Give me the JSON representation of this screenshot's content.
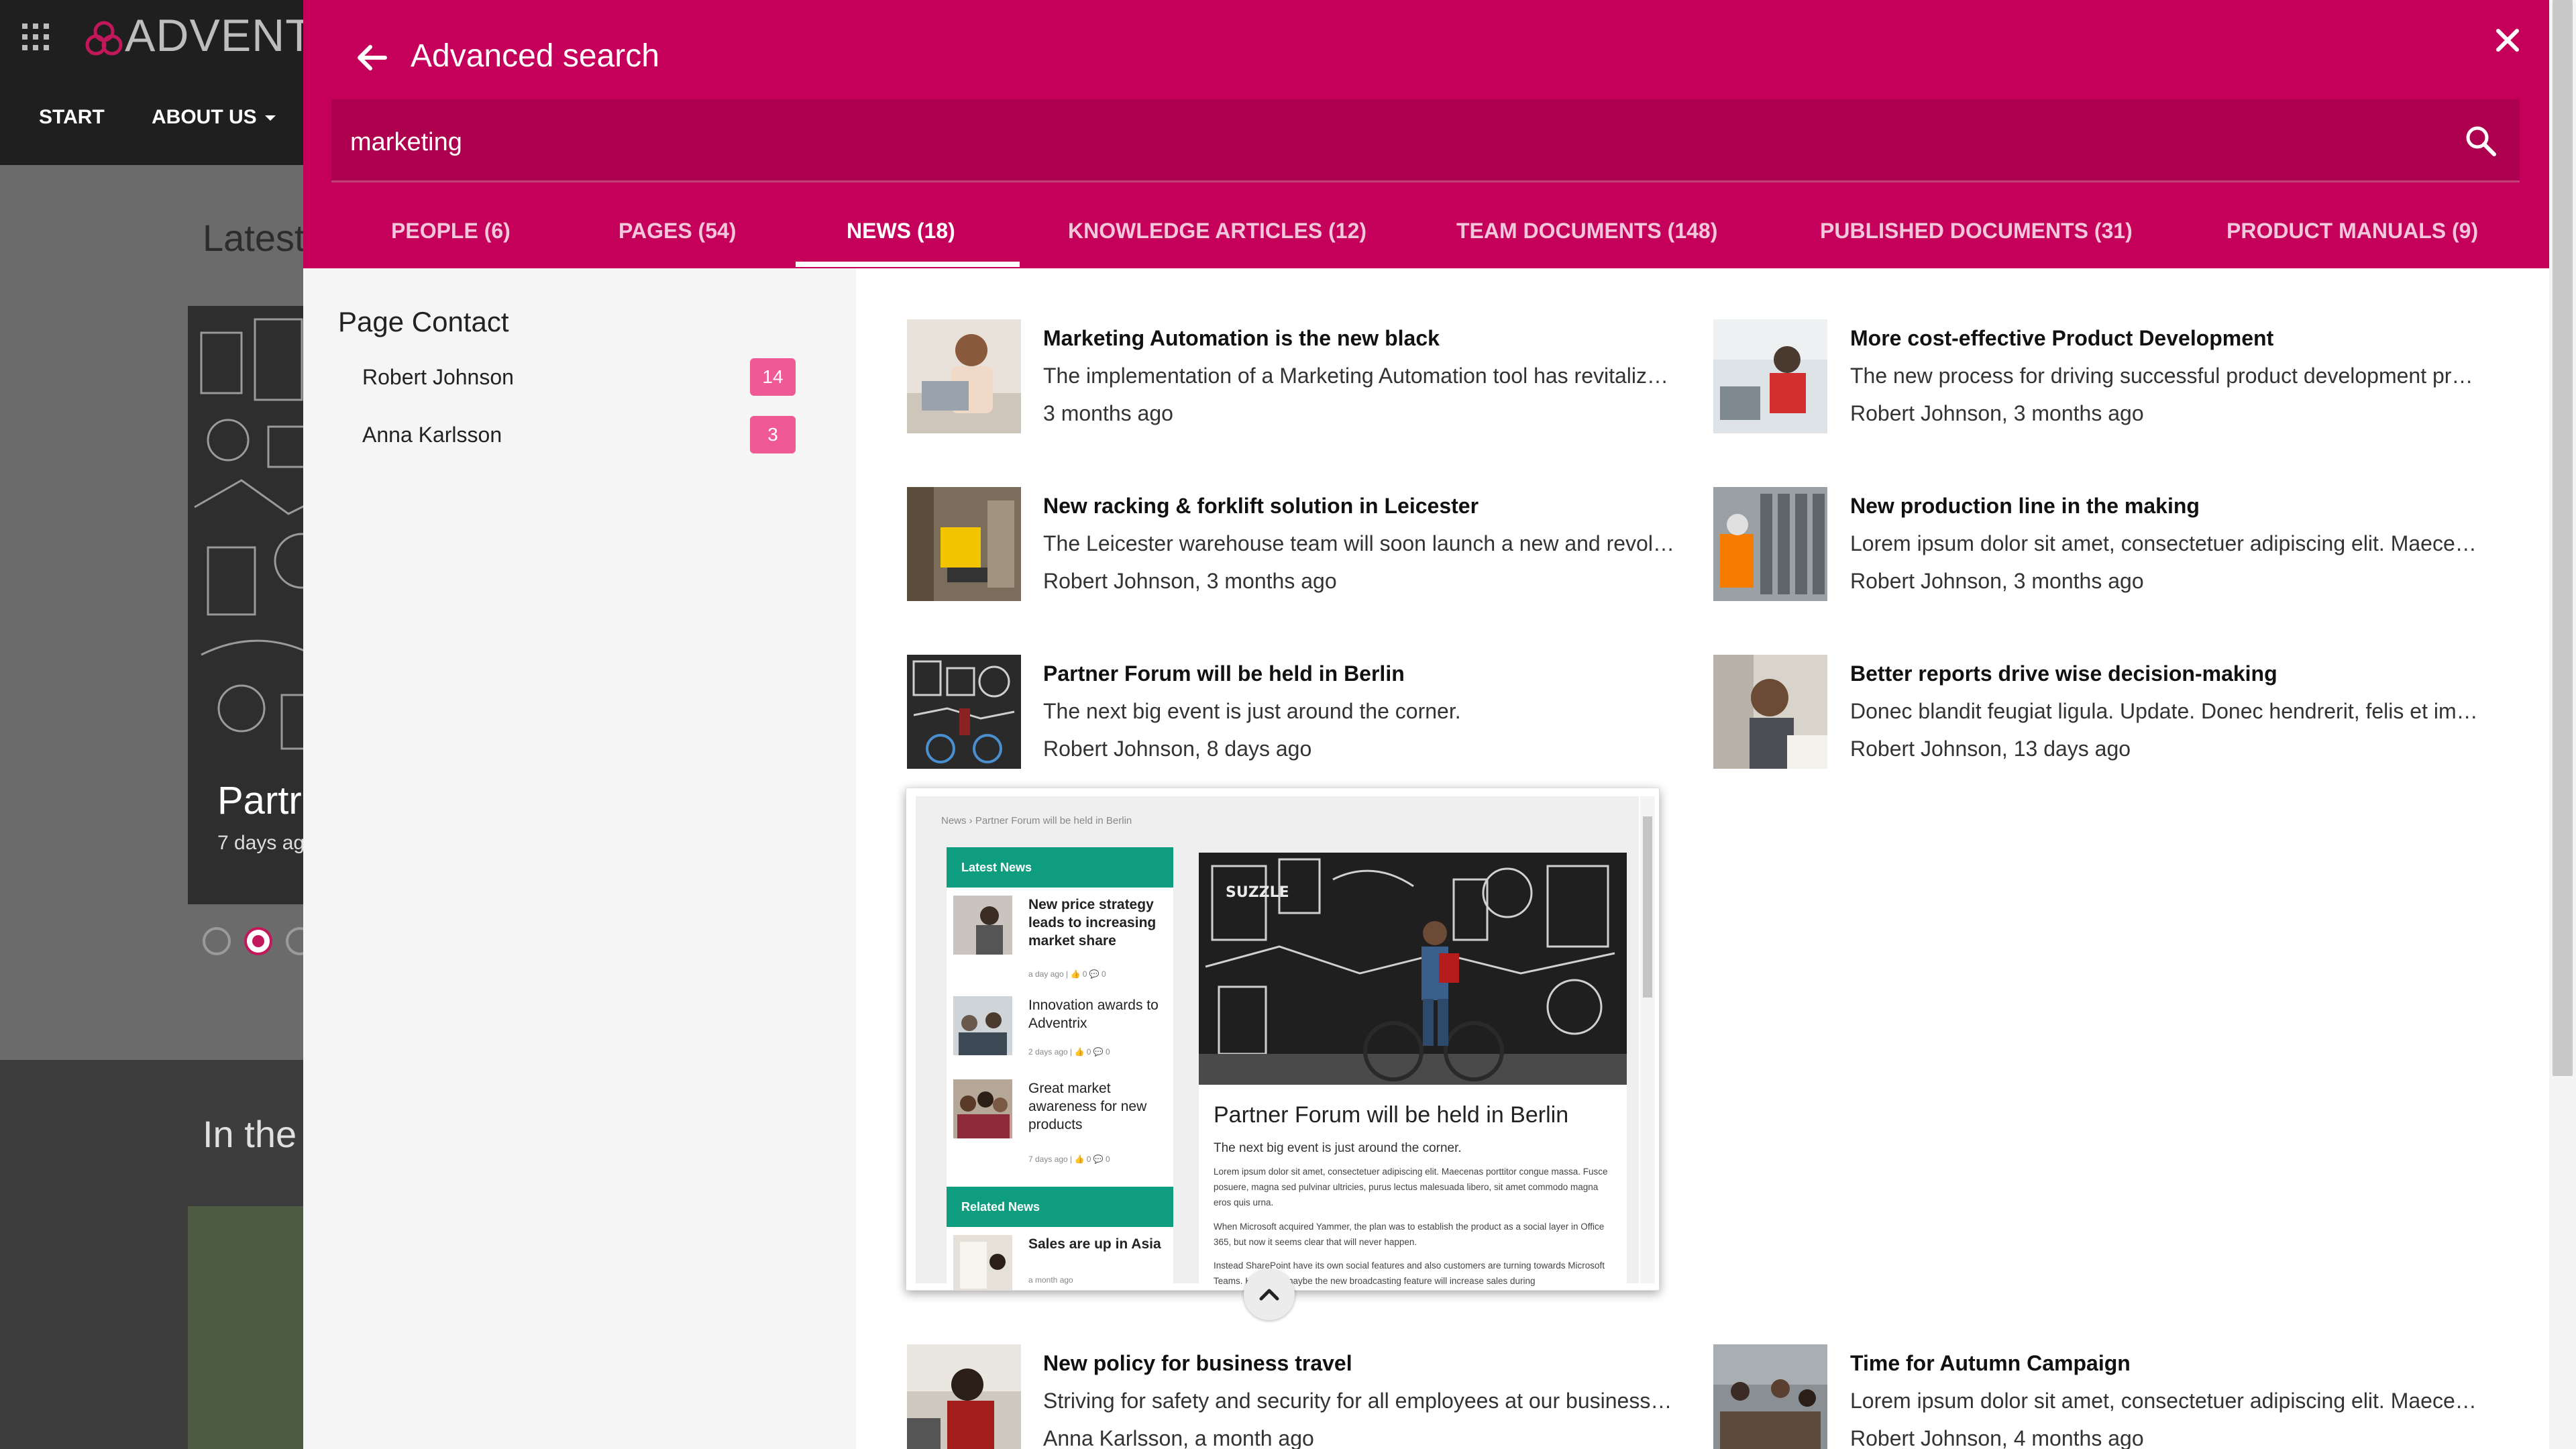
{
  "background_page": {
    "logo_text": "ADVENTRI",
    "nav": [
      "START",
      "ABOUT US"
    ],
    "latest_heading": "Latest",
    "slide_title": "Partr",
    "slide_date": "7 days ag",
    "in_the_heading": "In the"
  },
  "search_panel": {
    "title": "Advanced search",
    "query": "marketing",
    "accent_color": "#c4005a"
  },
  "tabs": [
    {
      "label": "PEOPLE (6)",
      "active": false
    },
    {
      "label": "PAGES (54)",
      "active": false
    },
    {
      "label": "NEWS (18)",
      "active": true
    },
    {
      "label": "KNOWLEDGE ARTICLES (12)",
      "active": false
    },
    {
      "label": "TEAM DOCUMENTS (148)",
      "active": false
    },
    {
      "label": "PUBLISHED DOCUMENTS (31)",
      "active": false
    },
    {
      "label": "PRODUCT MANUALS (9)",
      "active": false
    }
  ],
  "filter": {
    "title": "Page Contact",
    "items": [
      {
        "name": "Robert Johnson",
        "count": "14"
      },
      {
        "name": "Anna Karlsson",
        "count": "3"
      }
    ]
  },
  "results": [
    {
      "title": "Marketing Automation is the new black",
      "snippet": "The implementation of a Marketing Automation tool has revitaliz…",
      "meta": "3 months ago"
    },
    {
      "title": "More cost-effective Product Development",
      "snippet": "The new process for driving successful product development pr…",
      "meta": "Robert Johnson, 3 months ago"
    },
    {
      "title": "New racking & forklift solution in Leicester",
      "snippet": "The Leicester warehouse team will soon launch a new and revol…",
      "meta": "Robert Johnson, 3 months ago"
    },
    {
      "title": "New production line in the making",
      "snippet": "Lorem ipsum dolor sit amet, consectetuer adipiscing elit. Maece…",
      "meta": "Robert Johnson, 3 months ago"
    },
    {
      "title": "Partner Forum will be held in Berlin",
      "snippet": "The next big event is just around the corner.",
      "meta": "Robert Johnson, 8 days ago"
    },
    {
      "title": "Better reports drive wise decision-making",
      "snippet": "Donec blandit feugiat ligula. Update. Donec hendrerit, felis et im…",
      "meta": "Robert Johnson, 13 days ago"
    },
    {
      "title": "New policy for business travel",
      "snippet": "Striving for safety and security for all employees at our business…",
      "meta": "Anna Karlsson, a month ago"
    },
    {
      "title": "Time for Autumn Campaign",
      "snippet": "Lorem ipsum dolor sit amet, consectetuer adipiscing elit. Maece…",
      "meta": "Robert Johnson, 4 months ago"
    }
  ],
  "preview": {
    "breadcrumb": "News  ›  Partner Forum will be held in Berlin",
    "latest_news_heading": "Latest News",
    "latest_news": [
      {
        "title": "New price strategy leads to increasing market share",
        "meta": "a day ago  |  👍 0  💬 0"
      },
      {
        "title": "Innovation awards to Adventrix",
        "meta": "2 days ago  |  👍 0  💬 0"
      },
      {
        "title": "Great market awareness for new products",
        "meta": "7 days ago  |  👍 0  💬 0"
      }
    ],
    "related_news_heading": "Related News",
    "related_news": [
      {
        "title": "Sales are up in Asia",
        "meta": "a month ago"
      }
    ],
    "article_title": "Partner Forum will be held in Berlin",
    "article_subtitle": "The next big event is just around the corner.",
    "paragraphs": [
      "Lorem ipsum dolor sit amet, consectetuer adipiscing elit. Maecenas porttitor congue massa. Fusce posuere, magna sed pulvinar ultricies, purus lectus malesuada libero, sit amet commodo magna eros quis urna.",
      "When Microsoft acquired Yammer, the plan was to establish the product as a social layer in Office 365, but now it seems clear that will never happen.",
      "Instead SharePoint have its own social features and also customers are turning towards Microsoft Teams. However, maybe the new broadcasting feature will increase sales during"
    ],
    "accent_color": "#0f9d7f"
  },
  "icons": [
    "apps-grid-icon",
    "logo-icon",
    "chevron-down-icon",
    "back-arrow-icon",
    "close-icon",
    "search-icon",
    "chevron-up-icon"
  ]
}
